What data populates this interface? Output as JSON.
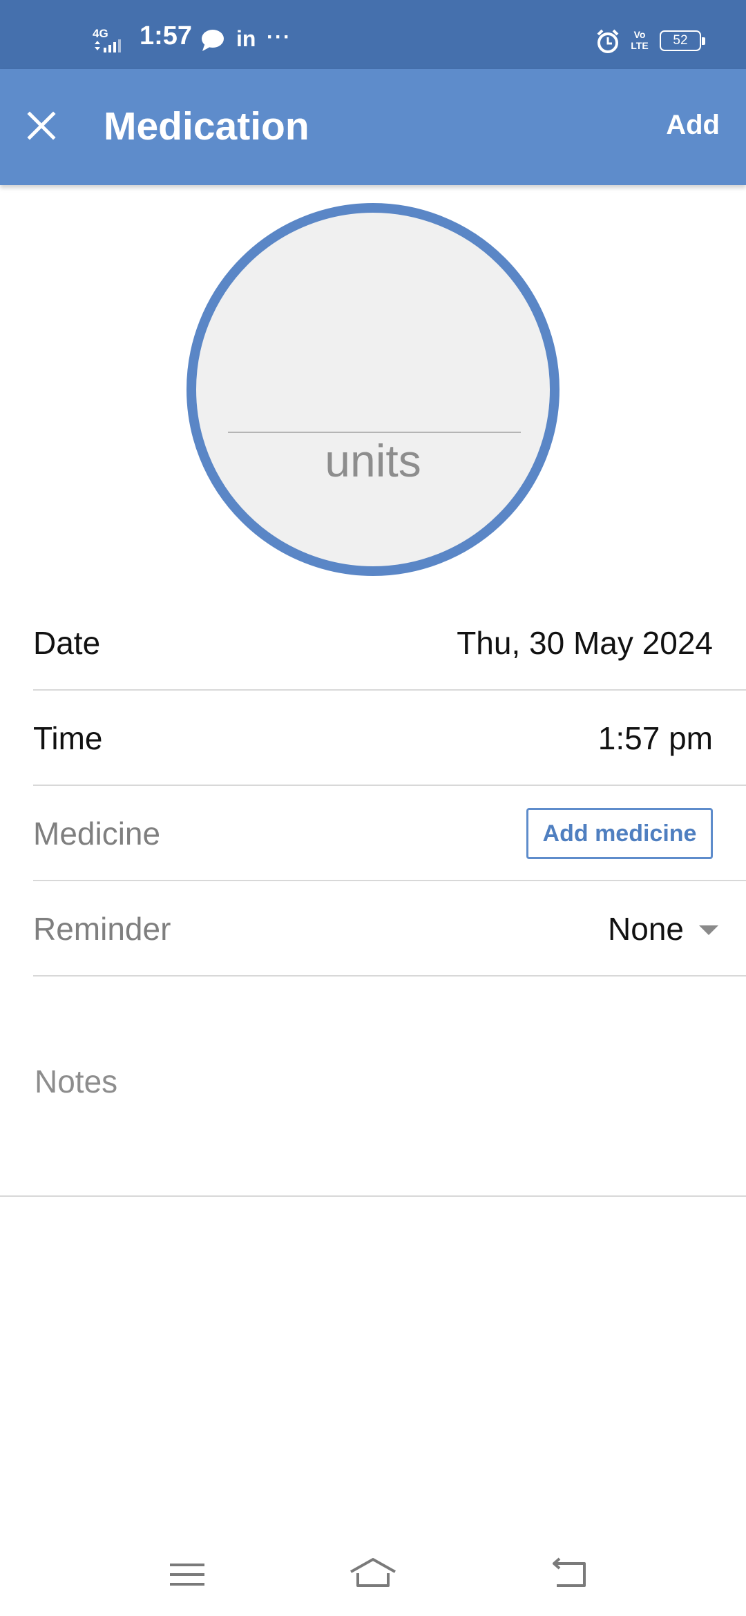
{
  "status_bar": {
    "network": "4G",
    "time": "1:57",
    "app_icons": [
      "chat-bubble-icon",
      "linkedin-icon",
      "more-dots-icon"
    ],
    "linkedin_text": "in",
    "more_text": "···",
    "volte_text": "Vo LTE",
    "battery": "52"
  },
  "toolbar": {
    "close_icon": "close-icon",
    "title": "Medication",
    "add_label": "Add",
    "color": "#5e8ccb"
  },
  "dial": {
    "value": "",
    "units_label": "units",
    "ring_color": "#5a86c6"
  },
  "form": {
    "date": {
      "label": "Date",
      "value": "Thu, 30 May 2024"
    },
    "time": {
      "label": "Time",
      "value": "1:57 pm"
    },
    "medicine": {
      "label": "Medicine",
      "button_label": "Add medicine"
    },
    "reminder": {
      "label": "Reminder",
      "value": "None"
    },
    "notes": {
      "placeholder": "Notes",
      "value": ""
    }
  },
  "nav_bar": {
    "icons": [
      "menu-icon",
      "home-icon",
      "back-icon"
    ]
  }
}
